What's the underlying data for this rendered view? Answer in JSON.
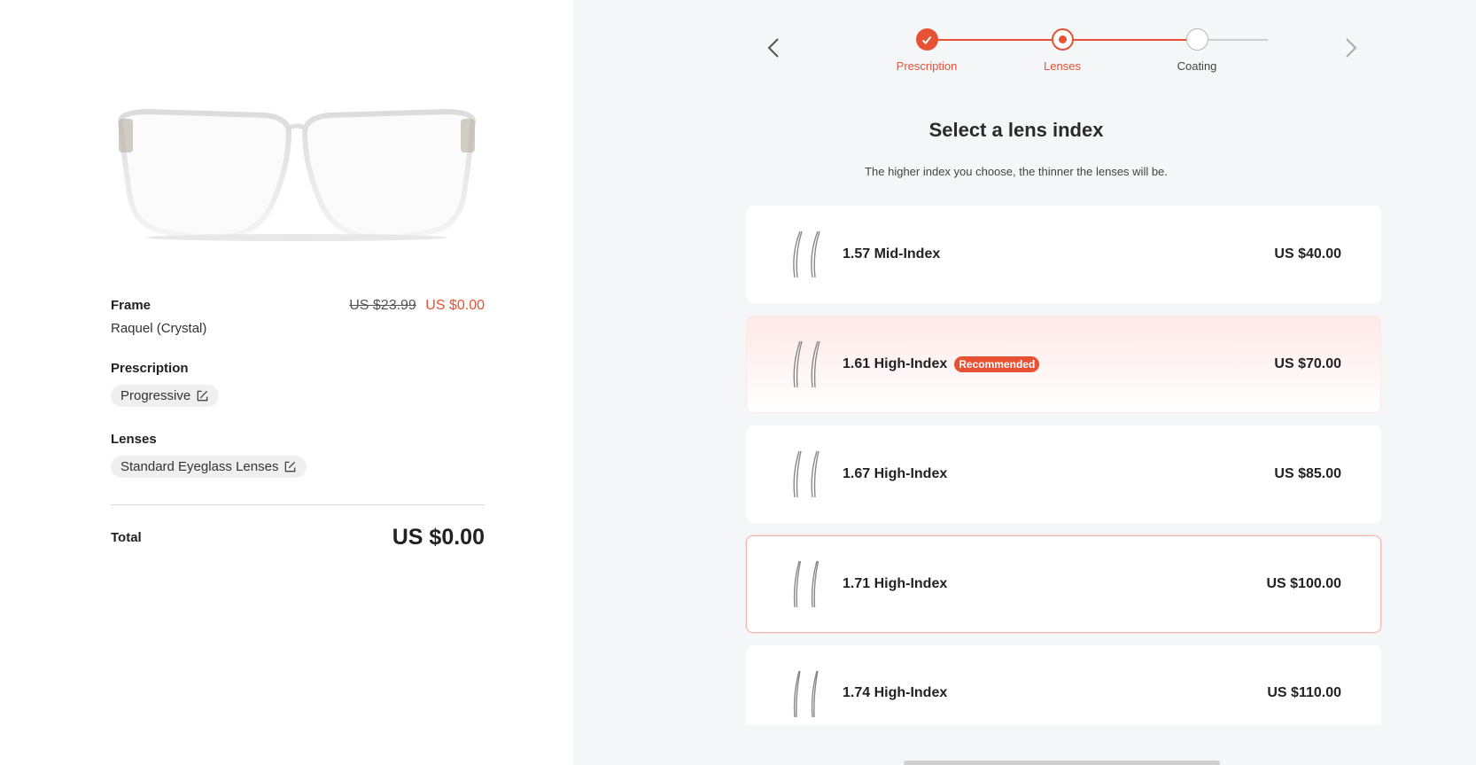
{
  "summary": {
    "frame_label": "Frame",
    "frame_name": "Raquel (Crystal)",
    "frame_price_old": "US $23.99",
    "frame_price_new": "US $0.00",
    "prescription_label": "Prescription",
    "prescription_value": "Progressive",
    "lenses_label": "Lenses",
    "lenses_value": "Standard Eyeglass Lenses",
    "total_label": "Total",
    "total_value": "US $0.00"
  },
  "stepper": {
    "steps": [
      {
        "label": "Prescription",
        "state": "done"
      },
      {
        "label": "Lenses",
        "state": "active"
      },
      {
        "label": "Coating",
        "state": "todo"
      }
    ]
  },
  "main": {
    "title": "Select a lens index",
    "subtitle": "The higher index you choose, the thinner the lenses will be.",
    "options": [
      {
        "name": "1.57 Mid-Index",
        "price": "US $40.00"
      },
      {
        "name": "1.61 High-Index",
        "price": "US $70.00",
        "badge": "Recommended"
      },
      {
        "name": "1.67 High-Index",
        "price": "US $85.00"
      },
      {
        "name": "1.71 High-Index",
        "price": "US $100.00"
      },
      {
        "name": "1.74 High-Index",
        "price": "US $110.00"
      }
    ]
  },
  "colors": {
    "accent": "#e85234",
    "panel_bg": "#f5f6f8"
  },
  "icons": {
    "prev": "chevron-left-icon",
    "next": "chevron-right-icon",
    "edit": "edit-icon",
    "check": "check-icon",
    "lens": "lens-profile-icon"
  }
}
